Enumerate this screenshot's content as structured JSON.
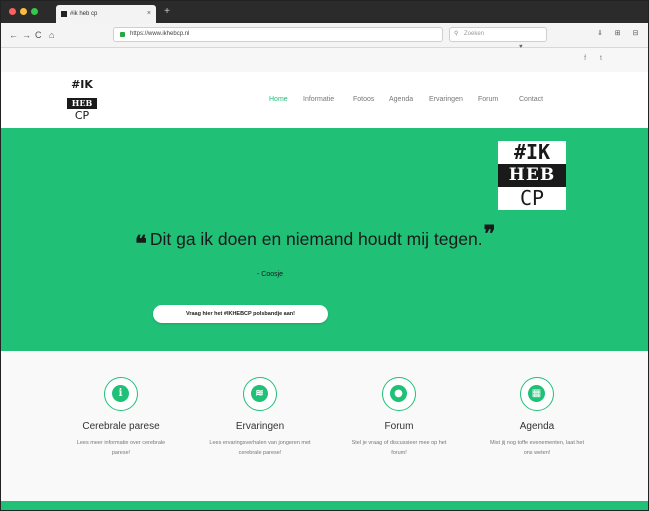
{
  "browser": {
    "tab_title": "#ik heb cp",
    "new_tab": "+",
    "tab_close": "×",
    "nav_back": "←",
    "nav_forward": "→",
    "nav_reload": "C",
    "nav_home": "⌂",
    "url": "https://www.ikhebcp.nl",
    "url_icons": "··· ♥ ☆",
    "search_placeholder": "Zoeken",
    "search_icon": "⚲",
    "toolbar_icons": "⇓ ⊞ ⊟"
  },
  "social": {
    "icons": "f t"
  },
  "logo": {
    "line1": "#IK",
    "line2": "HEB",
    "line3": "CP"
  },
  "menu": [
    {
      "label": "Home",
      "active": true
    },
    {
      "label": "Informatie",
      "active": false
    },
    {
      "label": "Fotoos",
      "active": false
    },
    {
      "label": "Agenda",
      "active": false
    },
    {
      "label": "Ervaringen",
      "active": false
    },
    {
      "label": "Forum",
      "active": false
    },
    {
      "label": "Contact",
      "active": false
    }
  ],
  "hero": {
    "logo": {
      "line1": "#IK",
      "line2": "HEB",
      "line3": "CP"
    },
    "quote_open": "❝",
    "quote": "Dit ga ik doen en niemand houdt mij tegen.",
    "quote_close": "❞",
    "author": "- Coosje",
    "cta": "Vraag hier het #IKHEBCP polsbandje aan!"
  },
  "features": [
    {
      "icon": "info-icon",
      "glyph": "i",
      "title": "Cerebrale parese",
      "desc": "Lees meer informatie over cerebrale parese!"
    },
    {
      "icon": "rss-icon",
      "glyph": "≋",
      "title": "Ervaringen",
      "desc": "Lees ervaringsverhalen van jongeren met cerebrale parese!"
    },
    {
      "icon": "chat-icon",
      "glyph": "●",
      "title": "Forum",
      "desc": "Stel je vraag of discussieer mee op het forum!"
    },
    {
      "icon": "calendar-icon",
      "glyph": "▦",
      "title": "Agenda",
      "desc": "Mist jij nog toffe evenementen, laat het ons weten!"
    }
  ],
  "colors": {
    "brand_green": "#20c077",
    "dark": "#1a1a1a"
  }
}
